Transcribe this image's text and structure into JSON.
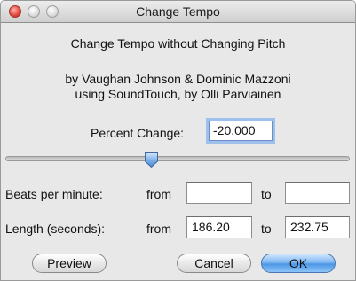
{
  "window": {
    "title": "Change Tempo"
  },
  "heading": "Change Tempo without Changing Pitch",
  "credits": {
    "line1": "by Vaughan Johnson & Dominic Mazzoni",
    "line2": "using SoundTouch, by Olli Parviainen"
  },
  "percent_change": {
    "label": "Percent Change:",
    "value": "-20.000"
  },
  "slider": {
    "value_percent": -20.0
  },
  "beats_per_minute": {
    "label": "Beats per minute:",
    "from_label": "from",
    "to_label": "to",
    "from_value": "",
    "to_value": ""
  },
  "length_seconds": {
    "label": "Length (seconds):",
    "from_label": "from",
    "to_label": "to",
    "from_value": "186.20",
    "to_value": "232.75"
  },
  "buttons": {
    "preview": "Preview",
    "cancel": "Cancel",
    "ok": "OK"
  },
  "colors": {
    "focus_ring": "#9fc0ec",
    "default_button": "#5aa0ea",
    "close_button": "#e0443a"
  }
}
